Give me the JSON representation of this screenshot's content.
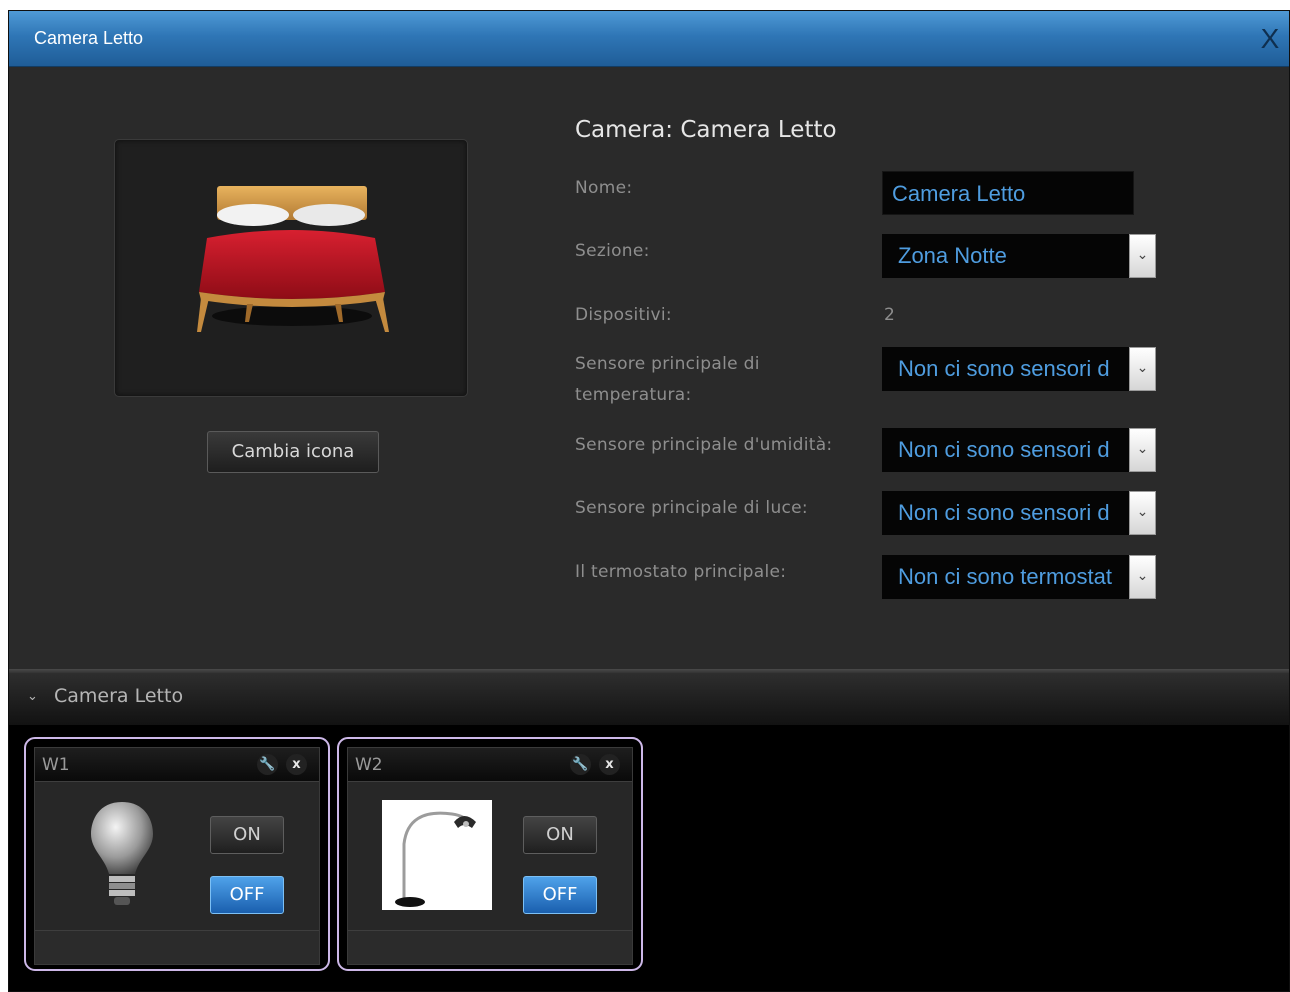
{
  "window": {
    "title": "Camera Letto",
    "close_label": "X"
  },
  "room_icon": {
    "name": "bed-icon",
    "change_label": "Cambia icona"
  },
  "form": {
    "heading": "Camera: Camera Letto",
    "nome": {
      "label": "Nome:",
      "value": "Camera Letto"
    },
    "sezione": {
      "label": "Sezione:",
      "value": "Zona Notte"
    },
    "dispositivi": {
      "label": "Dispositivi:",
      "value": "2"
    },
    "temperatura": {
      "label": "Sensore principale di temperatura:",
      "value": "Non ci sono sensori d"
    },
    "umidita": {
      "label": "Sensore principale d'umidità:",
      "value": "Non ci sono sensori d"
    },
    "luce": {
      "label": "Sensore principale di luce:",
      "value": "Non ci sono sensori d"
    },
    "termostato": {
      "label": "Il termostato principale:",
      "value": "Non ci sono termostat"
    },
    "dropdown_glyph": "⌄"
  },
  "section": {
    "title": "Camera Letto",
    "collapse_glyph": "⌄"
  },
  "widgets": [
    {
      "title": "W1",
      "settings_glyph": "🔧",
      "close_glyph": "x",
      "on_label": "ON",
      "off_label": "OFF",
      "icon": "light-bulb-icon"
    },
    {
      "title": "W2",
      "settings_glyph": "🔧",
      "close_glyph": "x",
      "on_label": "ON",
      "off_label": "OFF",
      "icon": "floor-lamp-icon"
    }
  ],
  "colors": {
    "accent": "#4f9de0",
    "titlebar": "#2f76b6",
    "widget_border": "#cdb8e8"
  }
}
